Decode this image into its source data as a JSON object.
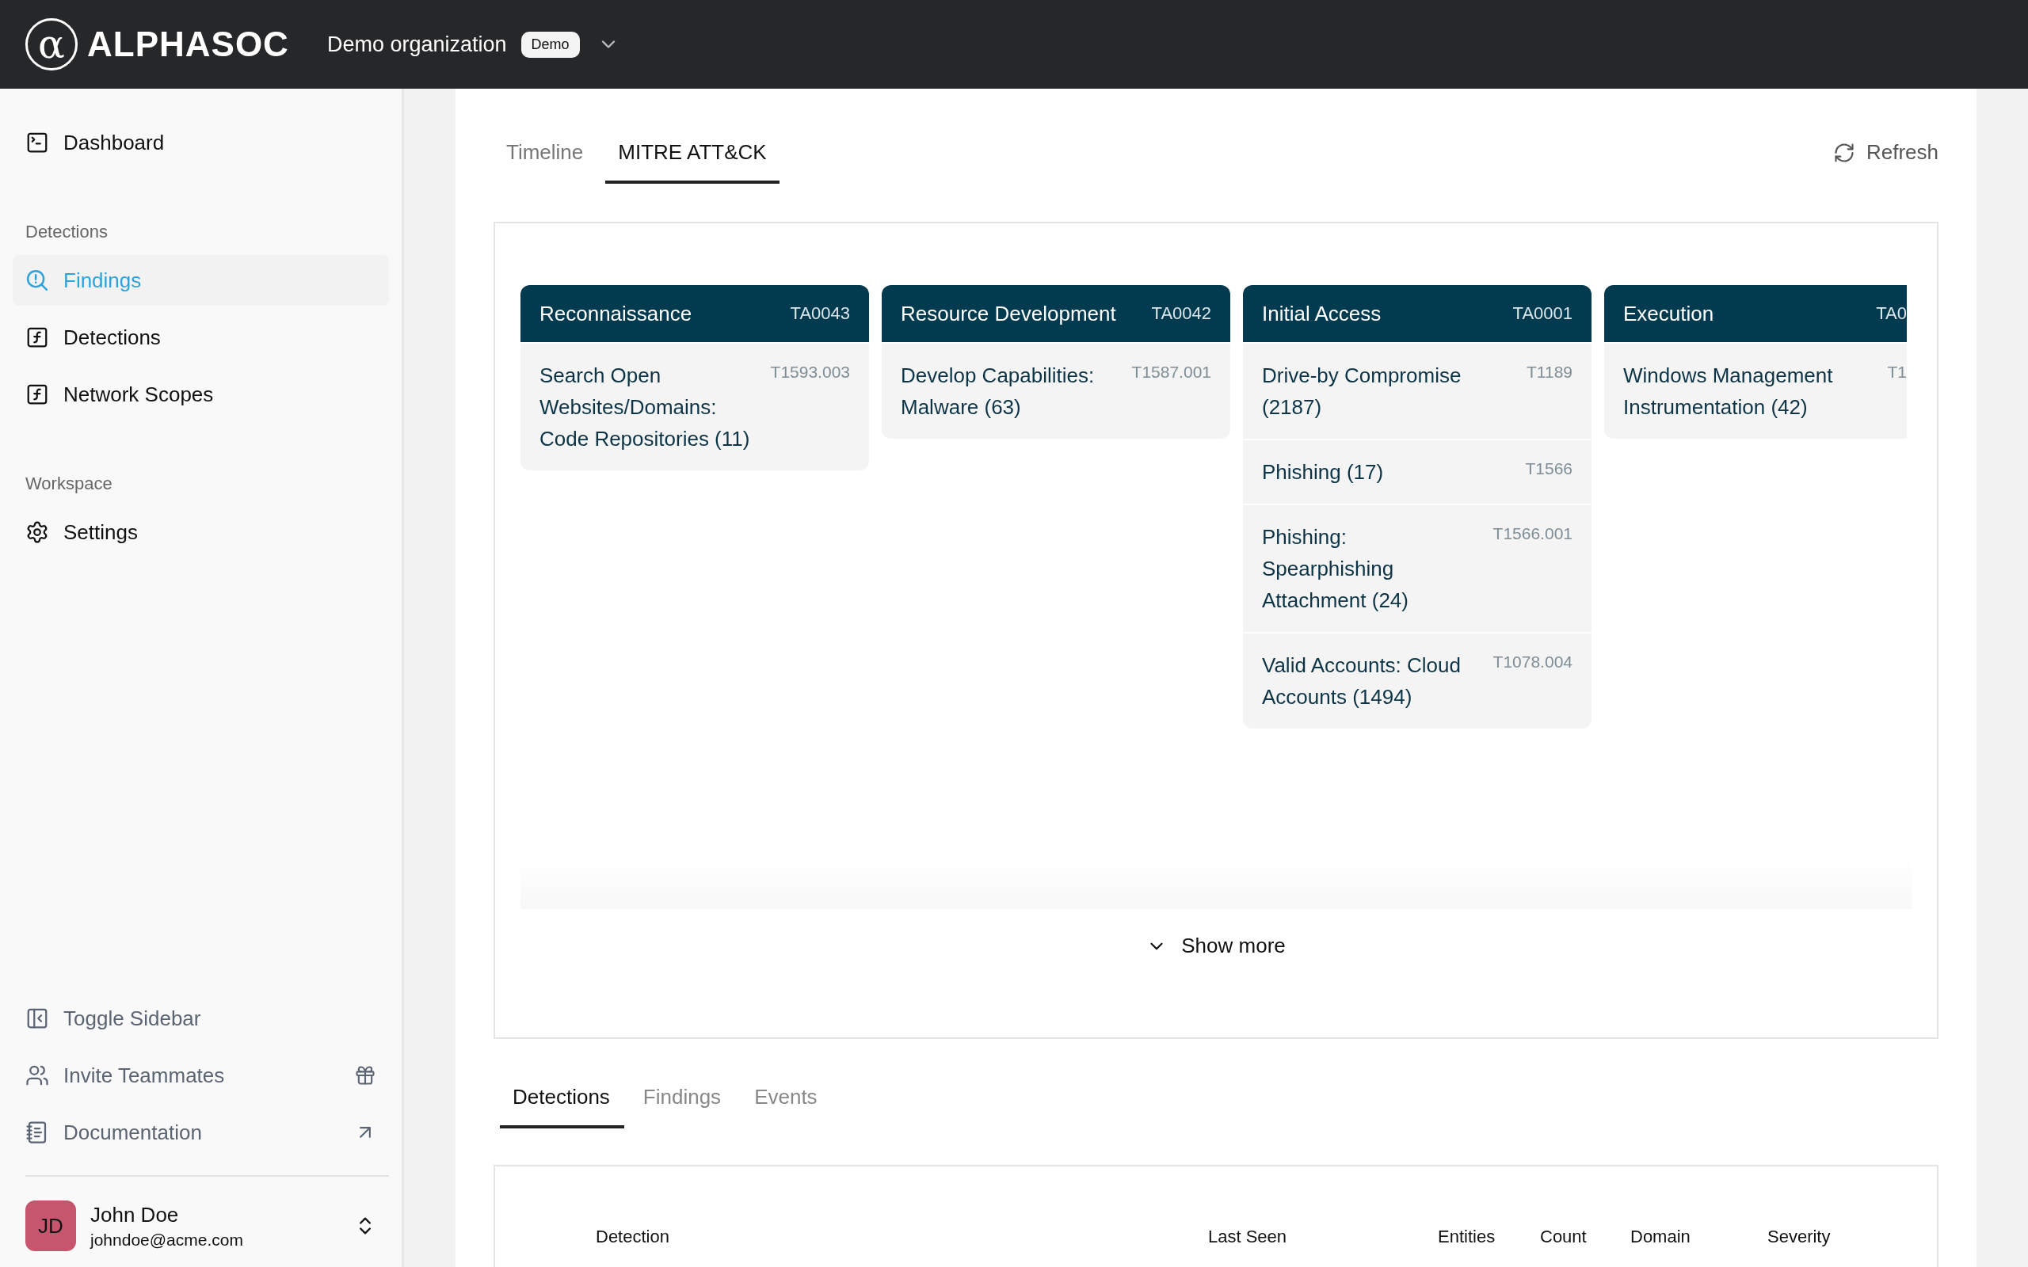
{
  "header": {
    "logo_mark": "α",
    "logo_text": "ALPHASOC",
    "organization": "Demo organization",
    "badge": "Demo"
  },
  "sidebar": {
    "sections": [
      {
        "items": [
          {
            "label": "Dashboard",
            "selected": false
          }
        ]
      },
      {
        "label": "Detections",
        "items": [
          {
            "label": "Findings",
            "selected": true
          },
          {
            "label": "Detections",
            "selected": false
          },
          {
            "label": "Network Scopes",
            "selected": false
          }
        ]
      },
      {
        "label": "Workspace",
        "items": [
          {
            "label": "Settings",
            "selected": false
          }
        ]
      }
    ],
    "footer_items": [
      {
        "label": "Toggle Sidebar"
      },
      {
        "label": "Invite Teammates"
      },
      {
        "label": "Documentation"
      }
    ],
    "user": {
      "initials": "JD",
      "name": "John Doe",
      "email": "johndoe@acme.com"
    }
  },
  "view_tabs": [
    {
      "label": "Timeline",
      "selected": false
    },
    {
      "label": "MITRE ATT&CK",
      "selected": true
    }
  ],
  "refresh": "Refresh",
  "tactics": [
    {
      "name": "Reconnaissance",
      "id": "TA0043",
      "clipped": false,
      "techniques": [
        {
          "name": "Search Open Websites/Domains: Code Repositories (11)",
          "id": "T1593.003"
        }
      ]
    },
    {
      "name": "Resource Development",
      "id": "TA0042",
      "clipped": false,
      "techniques": [
        {
          "name": "Develop Capabilities: Malware (63)",
          "id": "T1587.001"
        }
      ]
    },
    {
      "name": "Initial Access",
      "id": "TA0001",
      "clipped": false,
      "techniques": [
        {
          "name": "Drive-by Compromise (2187)",
          "id": "T1189"
        },
        {
          "name": "Phishing (17)",
          "id": "T1566"
        },
        {
          "name": "Phishing: Spearphishing Attachment (24)",
          "id": "T1566.001"
        },
        {
          "name": "Valid Accounts: Cloud Accounts (1494)",
          "id": "T1078.004"
        }
      ]
    },
    {
      "name": "Execution",
      "id": "TA0",
      "clipped": true,
      "techniques": [
        {
          "name": "Windows Management Instrumentation (42)",
          "id": "T1"
        }
      ]
    }
  ],
  "show_more": "Show more",
  "bottom_tabs": [
    {
      "label": "Detections",
      "selected": true
    },
    {
      "label": "Findings",
      "selected": false
    },
    {
      "label": "Events",
      "selected": false
    }
  ],
  "table": {
    "columns": [
      "Detection",
      "Last Seen",
      "Entities",
      "Count",
      "Domain",
      "Severity"
    ]
  }
}
